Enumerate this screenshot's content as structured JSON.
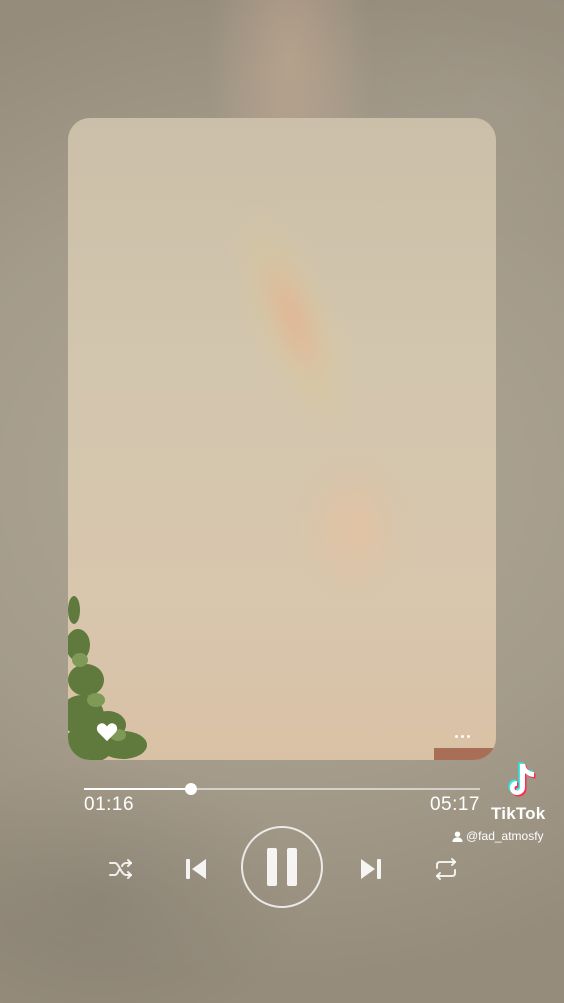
{
  "player": {
    "elapsed": "01:16",
    "total": "05:17",
    "progress": 0.27,
    "state": "playing"
  },
  "controls": {
    "shuffle_icon": "shuffle-icon",
    "previous_icon": "skip-previous-icon",
    "pause_icon": "pause-icon",
    "next_icon": "skip-next-icon",
    "repeat_icon": "repeat-icon"
  },
  "cover": {
    "like_icon": "heart-icon",
    "more_icon": "more-dots-icon"
  },
  "watermark": {
    "brand": "TikTok",
    "username": "@fad_atmosfy",
    "logo_icon": "tiktok-logo-icon",
    "user_icon": "person-icon"
  },
  "colors": {
    "foreground": "#ffffff",
    "background": "#a49b8a"
  }
}
